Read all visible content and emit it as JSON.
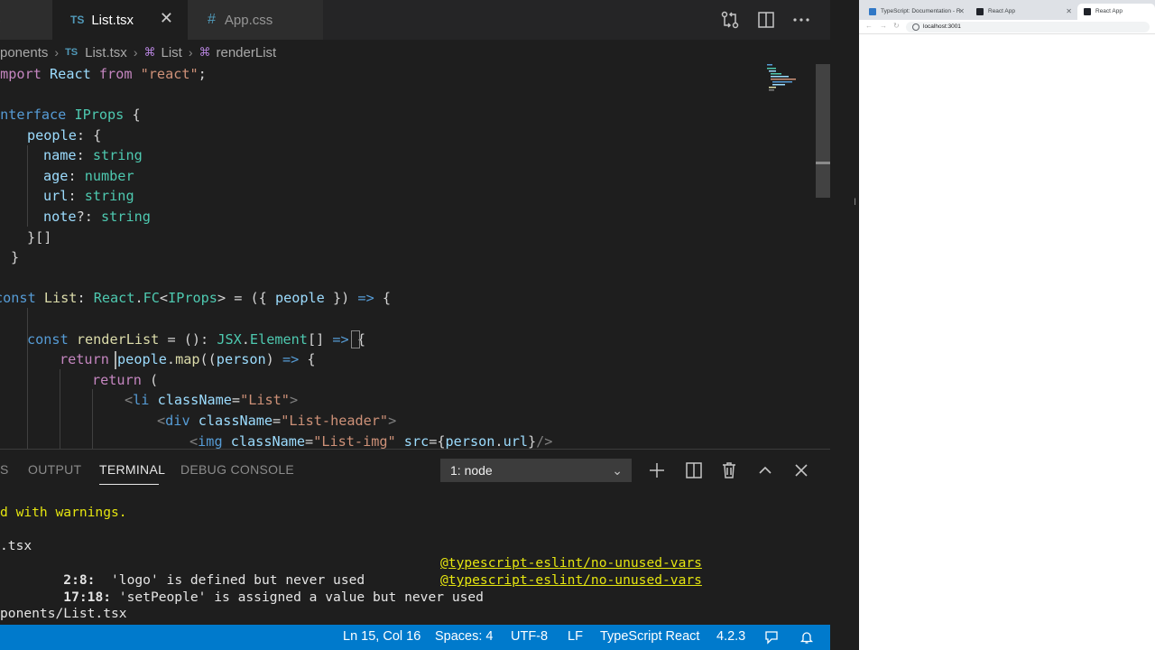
{
  "editor_tabs": [
    {
      "label": "List.tsx",
      "badge": "TS",
      "active": true
    },
    {
      "label": "App.css",
      "badge": "#",
      "active": false
    }
  ],
  "breadcrumb": [
    {
      "label": "ponents",
      "kind": "folder"
    },
    {
      "label": "List.tsx",
      "kind": "file"
    },
    {
      "label": "List",
      "kind": "symbol"
    },
    {
      "label": "renderList",
      "kind": "symbol"
    }
  ],
  "code_lines": [
    "import React from \"react\";",
    "",
    "interface IProps {",
    "    people: {",
    "      name: string",
    "      age: number",
    "      url: string",
    "      note?: string",
    "    }[]",
    "}",
    "",
    "const List: React.FC<IProps> = ({ people }) => {",
    "",
    "    const renderList = (): JSX.Element[] => {",
    "        return people.map((person) => {",
    "            return (",
    "                <li className=\"List\">",
    "                    <div className=\"List-header\">",
    "                        <img className=\"List-img\" src={person.url}/>"
  ],
  "panel": {
    "tabs": [
      "S",
      "OUTPUT",
      "TERMINAL",
      "DEBUG CONSOLE"
    ],
    "active_tab": "TERMINAL",
    "terminal_select": "1: node"
  },
  "terminal_lines": {
    "line1": "d with warnings.",
    "line2": ".tsx",
    "line3_loc": "2:8:",
    "line3_msg": "  'logo' is defined but never used",
    "line3_rule": "@typescript-eslint/no-unused-vars",
    "line4_loc": "17:18:",
    "line4_msg": " 'setPeople' is assigned a value but never used",
    "line4_rule": "@typescript-eslint/no-unused-vars",
    "line5": "ponents/List.tsx"
  },
  "statusbar": {
    "position": "Ln 15, Col 16",
    "spaces": "Spaces: 4",
    "encoding": "UTF-8",
    "eol": "LF",
    "language": "TypeScript React",
    "version": "4.2.3"
  },
  "browser": {
    "tabs": [
      {
        "label": "TypeScript: Documentation - R",
        "active": false
      },
      {
        "label": "React App",
        "active": false
      },
      {
        "label": "React App",
        "active": true
      }
    ],
    "url": "localhost:3001"
  },
  "colors": {
    "statusbar": "#007acc",
    "editor_bg": "#1e1e1e",
    "keyword": "#569cd6",
    "type": "#4ec9b0",
    "string": "#ce9178"
  }
}
